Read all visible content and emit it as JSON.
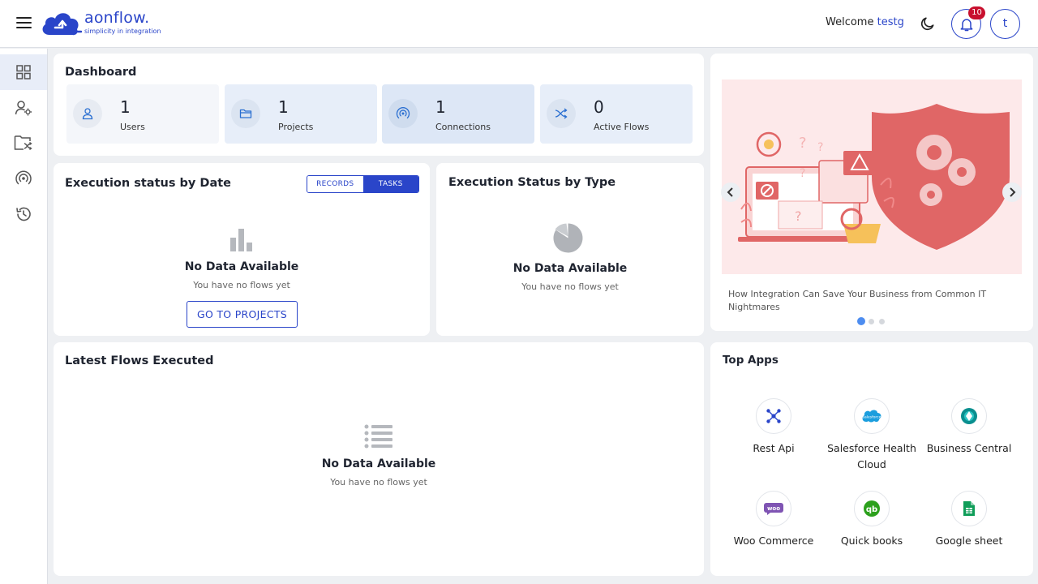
{
  "header": {
    "brand_name": "aonflow.",
    "brand_tagline": "simplicity in integration",
    "welcome_prefix": "Welcome",
    "username": "testg",
    "notification_count": "10",
    "avatar_initial": "t"
  },
  "sidebar": {
    "items": [
      {
        "name": "dashboard",
        "icon": "grid-icon",
        "active": true
      },
      {
        "name": "users",
        "icon": "user-settings-icon",
        "active": false
      },
      {
        "name": "projects",
        "icon": "folder-shuffle-icon",
        "active": false
      },
      {
        "name": "connections",
        "icon": "broadcast-icon",
        "active": false
      },
      {
        "name": "history",
        "icon": "history-icon",
        "active": false
      }
    ]
  },
  "dashboard": {
    "title": "Dashboard",
    "stats": [
      {
        "value": "1",
        "label": "Users",
        "icon": "user-icon"
      },
      {
        "value": "1",
        "label": "Projects",
        "icon": "folder-icon"
      },
      {
        "value": "1",
        "label": "Connections",
        "icon": "broadcast-icon"
      },
      {
        "value": "0",
        "label": "Active Flows",
        "icon": "shuffle-icon"
      }
    ]
  },
  "exec_by_date": {
    "title": "Execution status by Date",
    "toggle": {
      "records": "RECORDS",
      "tasks": "TASKS",
      "selected": "TASKS"
    },
    "empty_title": "No Data Available",
    "empty_sub": "You have no flows yet",
    "button": "GO TO PROJECTS"
  },
  "exec_by_type": {
    "title": "Execution Status by Type",
    "empty_title": "No Data Available",
    "empty_sub": "You have no flows yet"
  },
  "carousel": {
    "caption": "How Integration Can Save Your Business from Common IT Nightmares",
    "slide_count": 3,
    "active_slide": 1
  },
  "latest_flows": {
    "title": "Latest Flows Executed",
    "empty_title": "No Data Available",
    "empty_sub": "You have no flows yet"
  },
  "top_apps": {
    "title": "Top Apps",
    "apps": [
      {
        "name": "Rest Api",
        "icon": "rest-api-icon"
      },
      {
        "name": "Salesforce Health Cloud",
        "icon": "salesforce-icon"
      },
      {
        "name": "Business Central",
        "icon": "business-central-icon"
      },
      {
        "name": "Woo Commerce",
        "icon": "woocommerce-icon"
      },
      {
        "name": "Quick books",
        "icon": "quickbooks-icon"
      },
      {
        "name": "Google sheet",
        "icon": "google-sheets-icon"
      }
    ]
  },
  "colors": {
    "accent": "#2a45c9",
    "notification": "#c8102e",
    "carousel_bg": "#fde9ea",
    "shield": "#e06666"
  }
}
